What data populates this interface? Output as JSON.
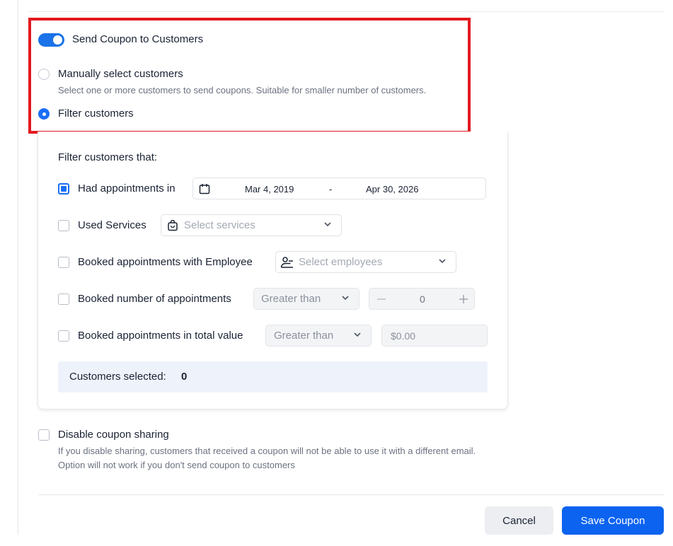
{
  "send_coupon": {
    "toggle_on": true,
    "label": "Send Coupon to Customers"
  },
  "selection_mode": {
    "manual": {
      "label": "Manually select customers",
      "description": "Select one or more customers to send coupons. Suitable for smaller number of customers.",
      "selected": false
    },
    "filter": {
      "label": "Filter customers",
      "selected": true
    }
  },
  "filter_panel": {
    "title": "Filter customers that:",
    "had_appointments": {
      "label": "Had appointments in",
      "checked": true,
      "date_from": "Mar 4, 2019",
      "date_separator": "-",
      "date_to": "Apr 30, 2026"
    },
    "used_services": {
      "label": "Used Services",
      "checked": false,
      "placeholder": "Select services"
    },
    "employee": {
      "label": "Booked appointments with Employee",
      "checked": false,
      "placeholder": "Select employees"
    },
    "num_appointments": {
      "label": "Booked number of appointments",
      "checked": false,
      "comparator": "Greater than",
      "value": "0"
    },
    "total_value": {
      "label": "Booked appointments in total value",
      "checked": false,
      "comparator": "Greater than",
      "placeholder": "$0.00"
    },
    "customers_selected_label": "Customers selected:",
    "customers_selected_count": "0"
  },
  "disable_sharing": {
    "label": "Disable coupon sharing",
    "checked": false,
    "description_line1": "If you disable sharing, customers that received a coupon will not be able to use it with a different email.",
    "description_line2": "Option will not work if you don't send coupon to customers"
  },
  "actions": {
    "cancel_label": "Cancel",
    "save_label": "Save Coupon"
  },
  "colors": {
    "accent": "#1a6ef5",
    "highlight_border": "#e3191f",
    "save_button": "#0b63f0"
  },
  "icons": {
    "date": "calendar-icon",
    "services": "shopping-bag-icon",
    "employees": "employee-icon",
    "dropdown": "chevron-down-icon",
    "stepper_minus": "minus-icon",
    "stepper_plus": "plus-icon"
  }
}
